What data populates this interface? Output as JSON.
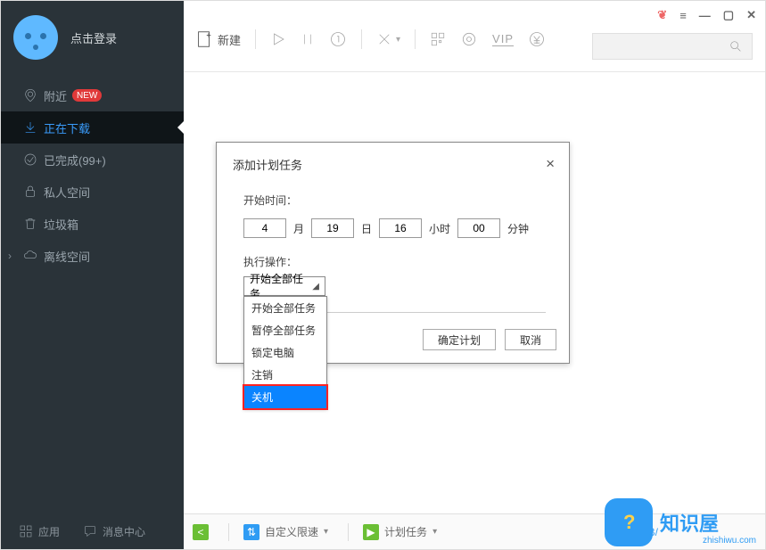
{
  "user": {
    "login_label": "点击登录"
  },
  "sidebar": {
    "items": [
      {
        "label": "附近",
        "badge": "NEW"
      },
      {
        "label": "正在下载"
      },
      {
        "label": "已完成(99+)"
      },
      {
        "label": "私人空间"
      },
      {
        "label": "垃圾箱"
      },
      {
        "label": "离线空间"
      }
    ],
    "bottom": {
      "apps": "应用",
      "msgs": "消息中心"
    }
  },
  "toolbar": {
    "new": "新建"
  },
  "modal": {
    "title": "添加计划任务",
    "close": "×",
    "start_time_label": "开始时间：",
    "month_val": "4",
    "month_unit": "月",
    "day_val": "19",
    "day_unit": "日",
    "hour_val": "16",
    "hour_unit": "小时",
    "minute_val": "00",
    "minute_unit": "分钟",
    "action_label": "执行操作：",
    "select_current": "开始全部任务",
    "options": [
      "开始全部任务",
      "暂停全部任务",
      "锁定电脑",
      "注销",
      "关机"
    ],
    "ok": "确定计划",
    "cancel": "取消"
  },
  "status": {
    "limit": "自定义限速",
    "plan": "计划任务",
    "speed": "0KB/"
  },
  "watermark": {
    "text": "知识屋",
    "sub": "zhishiwu.com"
  }
}
